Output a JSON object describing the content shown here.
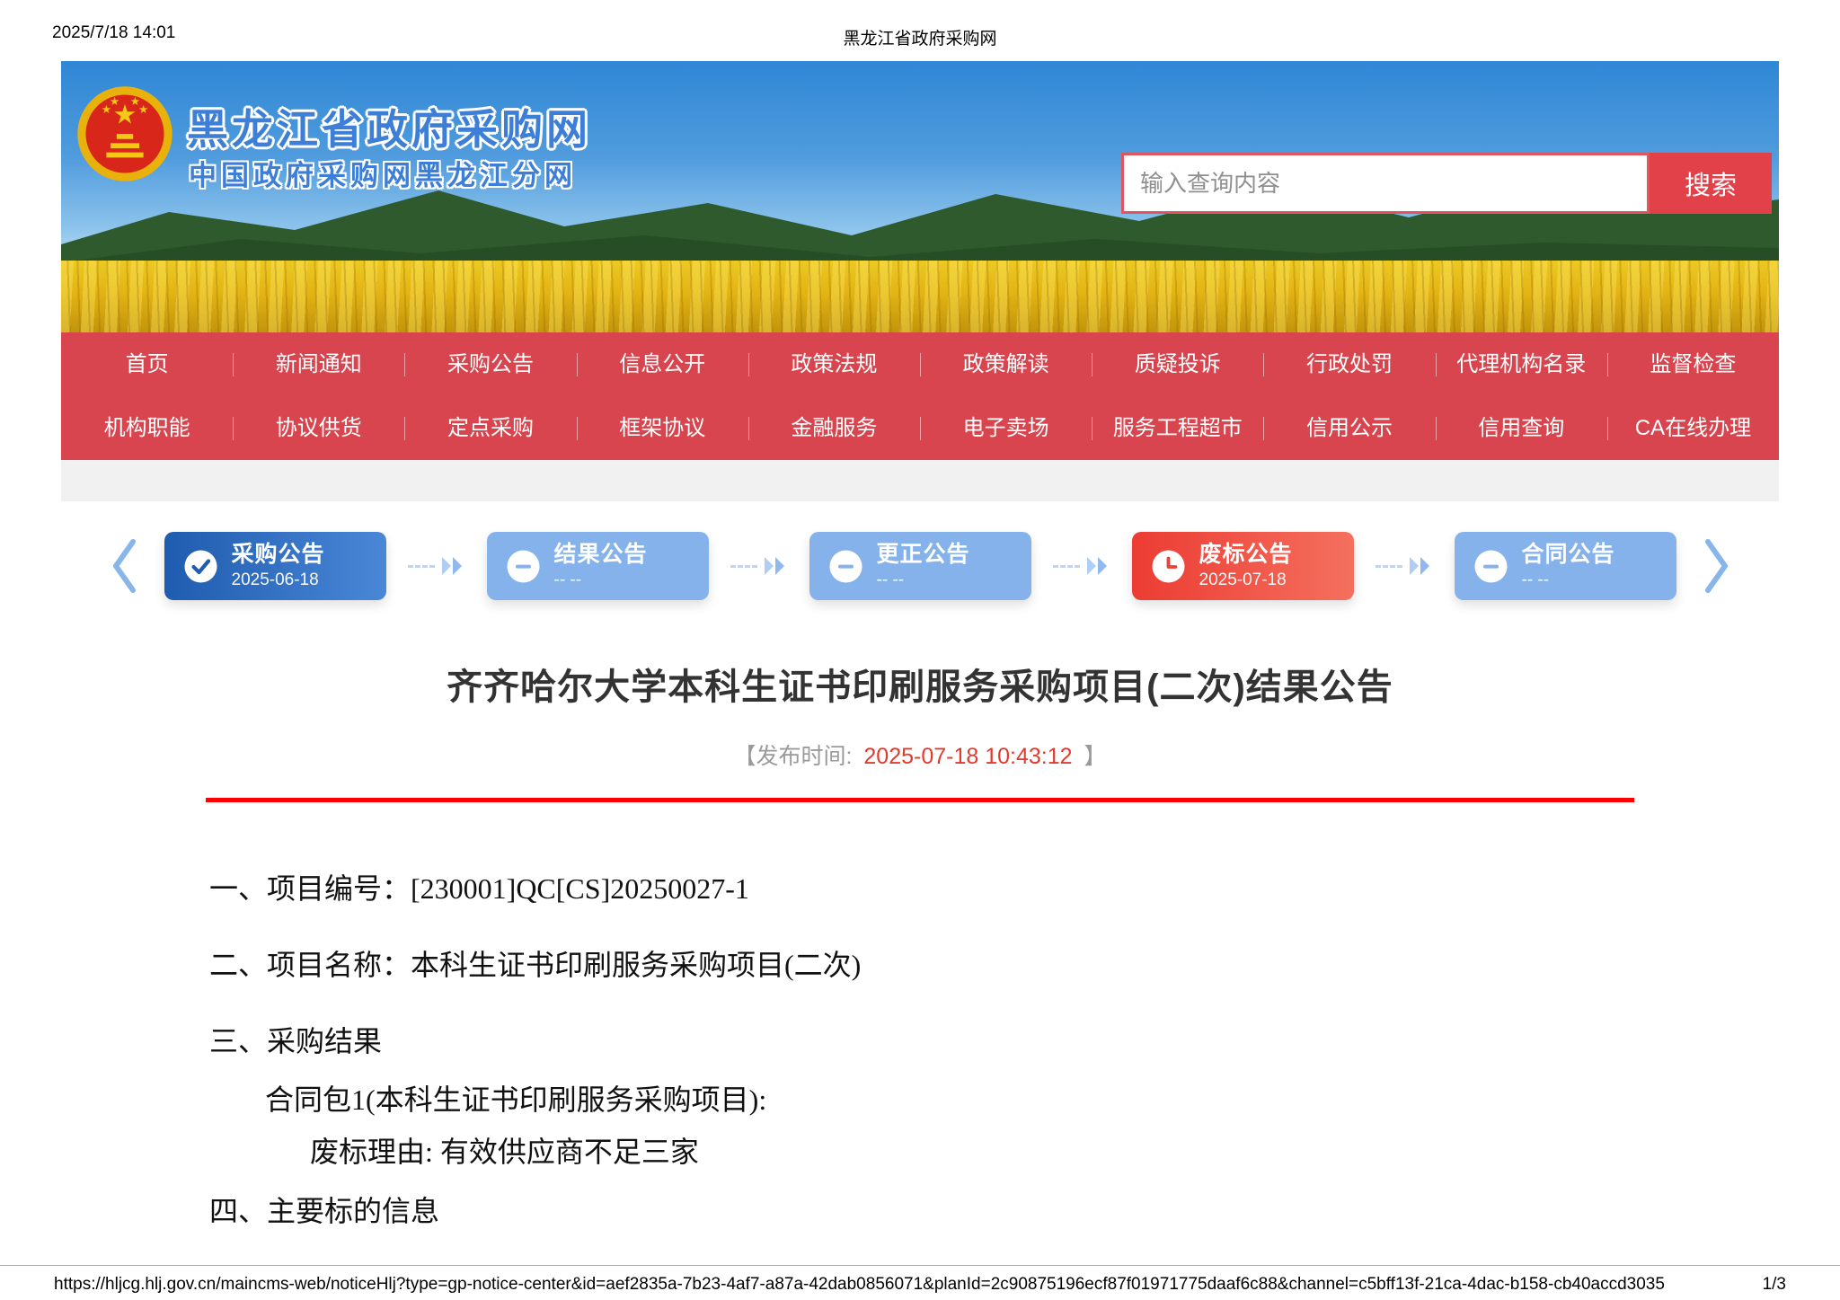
{
  "print_header": {
    "timestamp": "2025/7/18 14:01",
    "title": "黑龙江省政府采购网"
  },
  "banner": {
    "site_title": "黑龙江省政府采购网",
    "site_subtitle": "中国政府采购网黑龙江分网",
    "search": {
      "placeholder": "输入查询内容",
      "button_label": "搜索"
    }
  },
  "nav": {
    "row1": [
      "首页",
      "新闻通知",
      "采购公告",
      "信息公开",
      "政策法规",
      "政策解读",
      "质疑投诉",
      "行政处罚",
      "代理机构名录",
      "监督检查"
    ],
    "row2": [
      "机构职能",
      "协议供货",
      "定点采购",
      "框架协议",
      "金融服务",
      "电子卖场",
      "服务工程超市",
      "信用公示",
      "信用查询",
      "CA在线办理"
    ]
  },
  "stepper": {
    "steps": [
      {
        "label": "采购公告",
        "date": "2025-06-18",
        "state": "done",
        "icon": "check-icon"
      },
      {
        "label": "结果公告",
        "date": "-- --",
        "state": "pending",
        "icon": "minus-icon"
      },
      {
        "label": "更正公告",
        "date": "-- --",
        "state": "pending",
        "icon": "minus-icon"
      },
      {
        "label": "废标公告",
        "date": "2025-07-18",
        "state": "current",
        "icon": "clock-icon"
      },
      {
        "label": "合同公告",
        "date": "-- --",
        "state": "pending",
        "icon": "minus-icon"
      }
    ]
  },
  "article": {
    "title": "齐齐哈尔大学本科生证书印刷服务采购项目(二次)结果公告",
    "publish_prefix": "【发布时间: ",
    "publish_time": "2025-07-18 10:43:12",
    "publish_suffix": " 】",
    "paragraphs": [
      {
        "indent": 0,
        "text": "一、项目编号：[230001]QC[CS]20250027-1"
      },
      {
        "indent": 0,
        "text": "二、项目名称：本科生证书印刷服务采购项目(二次)"
      },
      {
        "indent": 0,
        "text": "三、采购结果"
      },
      {
        "indent": 1,
        "text": "合同包1(本科生证书印刷服务采购项目):"
      },
      {
        "indent": 2,
        "text": "废标理由: 有效供应商不足三家"
      },
      {
        "indent": 0,
        "text": "四、主要标的信息"
      }
    ]
  },
  "print_footer": {
    "url": "https://hljcg.hlj.gov.cn/maincms-web/noticeHlj?type=gp-notice-center&id=aef2835a-7b23-4af7-a87a-42dab0856071&planId=2c90875196ecf87f01971775daaf6c88&channel=c5bff13f-21ca-4dac-b158-cb40accd3035",
    "page": "1/3"
  },
  "colors": {
    "nav_red": "#d8454e",
    "search_btn_red": "#e2414a",
    "search_border_red": "#e0565c",
    "step_done_a": "#1f5caf",
    "step_done_b": "#4a87d7",
    "step_pending": "#86b2ec",
    "step_current_a": "#ec3c33",
    "step_current_b": "#f4705e",
    "arrow_blue": "#8fb9ef",
    "site_title_blue": "#3d7ed6",
    "publish_time_red": "#e43a2c",
    "divider_red": "#ff0000"
  }
}
